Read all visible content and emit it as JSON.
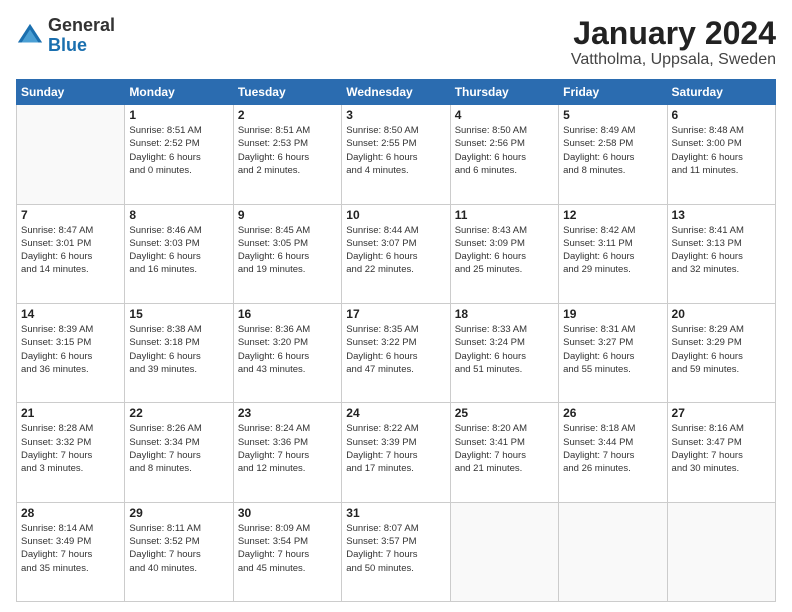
{
  "header": {
    "logo_general": "General",
    "logo_blue": "Blue",
    "month_year": "January 2024",
    "location": "Vattholma, Uppsala, Sweden"
  },
  "days_of_week": [
    "Sunday",
    "Monday",
    "Tuesday",
    "Wednesday",
    "Thursday",
    "Friday",
    "Saturday"
  ],
  "weeks": [
    [
      {
        "day": "",
        "text": ""
      },
      {
        "day": "1",
        "text": "Sunrise: 8:51 AM\nSunset: 2:52 PM\nDaylight: 6 hours\nand 0 minutes."
      },
      {
        "day": "2",
        "text": "Sunrise: 8:51 AM\nSunset: 2:53 PM\nDaylight: 6 hours\nand 2 minutes."
      },
      {
        "day": "3",
        "text": "Sunrise: 8:50 AM\nSunset: 2:55 PM\nDaylight: 6 hours\nand 4 minutes."
      },
      {
        "day": "4",
        "text": "Sunrise: 8:50 AM\nSunset: 2:56 PM\nDaylight: 6 hours\nand 6 minutes."
      },
      {
        "day": "5",
        "text": "Sunrise: 8:49 AM\nSunset: 2:58 PM\nDaylight: 6 hours\nand 8 minutes."
      },
      {
        "day": "6",
        "text": "Sunrise: 8:48 AM\nSunset: 3:00 PM\nDaylight: 6 hours\nand 11 minutes."
      }
    ],
    [
      {
        "day": "7",
        "text": "Sunrise: 8:47 AM\nSunset: 3:01 PM\nDaylight: 6 hours\nand 14 minutes."
      },
      {
        "day": "8",
        "text": "Sunrise: 8:46 AM\nSunset: 3:03 PM\nDaylight: 6 hours\nand 16 minutes."
      },
      {
        "day": "9",
        "text": "Sunrise: 8:45 AM\nSunset: 3:05 PM\nDaylight: 6 hours\nand 19 minutes."
      },
      {
        "day": "10",
        "text": "Sunrise: 8:44 AM\nSunset: 3:07 PM\nDaylight: 6 hours\nand 22 minutes."
      },
      {
        "day": "11",
        "text": "Sunrise: 8:43 AM\nSunset: 3:09 PM\nDaylight: 6 hours\nand 25 minutes."
      },
      {
        "day": "12",
        "text": "Sunrise: 8:42 AM\nSunset: 3:11 PM\nDaylight: 6 hours\nand 29 minutes."
      },
      {
        "day": "13",
        "text": "Sunrise: 8:41 AM\nSunset: 3:13 PM\nDaylight: 6 hours\nand 32 minutes."
      }
    ],
    [
      {
        "day": "14",
        "text": "Sunrise: 8:39 AM\nSunset: 3:15 PM\nDaylight: 6 hours\nand 36 minutes."
      },
      {
        "day": "15",
        "text": "Sunrise: 8:38 AM\nSunset: 3:18 PM\nDaylight: 6 hours\nand 39 minutes."
      },
      {
        "day": "16",
        "text": "Sunrise: 8:36 AM\nSunset: 3:20 PM\nDaylight: 6 hours\nand 43 minutes."
      },
      {
        "day": "17",
        "text": "Sunrise: 8:35 AM\nSunset: 3:22 PM\nDaylight: 6 hours\nand 47 minutes."
      },
      {
        "day": "18",
        "text": "Sunrise: 8:33 AM\nSunset: 3:24 PM\nDaylight: 6 hours\nand 51 minutes."
      },
      {
        "day": "19",
        "text": "Sunrise: 8:31 AM\nSunset: 3:27 PM\nDaylight: 6 hours\nand 55 minutes."
      },
      {
        "day": "20",
        "text": "Sunrise: 8:29 AM\nSunset: 3:29 PM\nDaylight: 6 hours\nand 59 minutes."
      }
    ],
    [
      {
        "day": "21",
        "text": "Sunrise: 8:28 AM\nSunset: 3:32 PM\nDaylight: 7 hours\nand 3 minutes."
      },
      {
        "day": "22",
        "text": "Sunrise: 8:26 AM\nSunset: 3:34 PM\nDaylight: 7 hours\nand 8 minutes."
      },
      {
        "day": "23",
        "text": "Sunrise: 8:24 AM\nSunset: 3:36 PM\nDaylight: 7 hours\nand 12 minutes."
      },
      {
        "day": "24",
        "text": "Sunrise: 8:22 AM\nSunset: 3:39 PM\nDaylight: 7 hours\nand 17 minutes."
      },
      {
        "day": "25",
        "text": "Sunrise: 8:20 AM\nSunset: 3:41 PM\nDaylight: 7 hours\nand 21 minutes."
      },
      {
        "day": "26",
        "text": "Sunrise: 8:18 AM\nSunset: 3:44 PM\nDaylight: 7 hours\nand 26 minutes."
      },
      {
        "day": "27",
        "text": "Sunrise: 8:16 AM\nSunset: 3:47 PM\nDaylight: 7 hours\nand 30 minutes."
      }
    ],
    [
      {
        "day": "28",
        "text": "Sunrise: 8:14 AM\nSunset: 3:49 PM\nDaylight: 7 hours\nand 35 minutes."
      },
      {
        "day": "29",
        "text": "Sunrise: 8:11 AM\nSunset: 3:52 PM\nDaylight: 7 hours\nand 40 minutes."
      },
      {
        "day": "30",
        "text": "Sunrise: 8:09 AM\nSunset: 3:54 PM\nDaylight: 7 hours\nand 45 minutes."
      },
      {
        "day": "31",
        "text": "Sunrise: 8:07 AM\nSunset: 3:57 PM\nDaylight: 7 hours\nand 50 minutes."
      },
      {
        "day": "",
        "text": ""
      },
      {
        "day": "",
        "text": ""
      },
      {
        "day": "",
        "text": ""
      }
    ]
  ]
}
